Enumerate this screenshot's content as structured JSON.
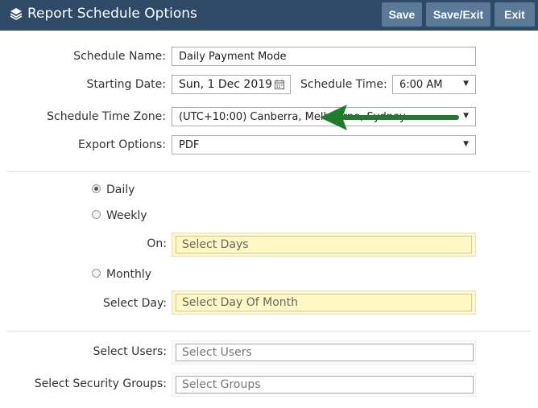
{
  "header": {
    "title": "Report Schedule Options",
    "title_icon": "layers-icon",
    "buttons": {
      "save": "Save",
      "save_exit": "Save/Exit",
      "exit": "Exit"
    }
  },
  "form": {
    "schedule_name": {
      "label": "Schedule Name:",
      "value": "Daily Payment Mode"
    },
    "starting_date": {
      "label": "Starting Date:",
      "value": "Sun, 1 Dec 2019",
      "icon": "calendar-icon"
    },
    "schedule_time": {
      "label": "Schedule Time:",
      "value": "6:00 AM"
    },
    "time_zone": {
      "label": "Schedule Time Zone:",
      "value": "(UTC+10:00) Canberra, Melbourne, Sydney"
    },
    "export_options": {
      "label": "Export Options:",
      "value": "PDF"
    }
  },
  "frequency": {
    "daily": {
      "label": "Daily",
      "selected": true
    },
    "weekly": {
      "label": "Weekly",
      "selected": false
    },
    "on": {
      "label": "On:",
      "placeholder": "Select Days"
    },
    "monthly": {
      "label": "Monthly",
      "selected": false
    },
    "select_day": {
      "label": "Select Day:",
      "placeholder": "Select Day Of Month"
    }
  },
  "recipients": {
    "users": {
      "label": "Select Users:",
      "placeholder": "Select Users"
    },
    "groups": {
      "label": "Select Security Groups:",
      "placeholder": "Select Groups"
    }
  },
  "colors": {
    "header_bg": "#2e4a66",
    "header_button": "#5a7a98",
    "highlight_field": "#fff7cc",
    "annotation_arrow": "#1e7d2a"
  }
}
